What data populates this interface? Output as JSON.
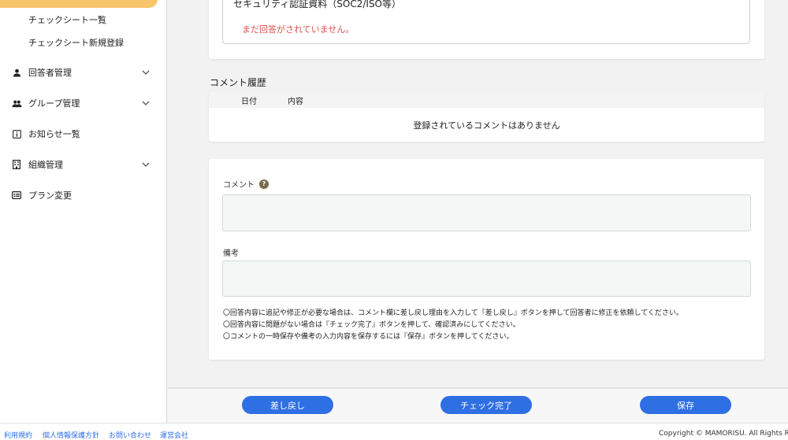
{
  "sidebar": {
    "sub_items": [
      "チェックシート一覧",
      "チェックシート新規登録"
    ],
    "items": [
      {
        "label": "回答者管理",
        "icon": "person-icon",
        "has_chevron": true
      },
      {
        "label": "グループ管理",
        "icon": "group-icon",
        "has_chevron": true
      },
      {
        "label": "お知らせ一覧",
        "icon": "info-icon",
        "has_chevron": false
      },
      {
        "label": "組織管理",
        "icon": "building-icon",
        "has_chevron": true
      },
      {
        "label": "プラン変更",
        "icon": "card-icon",
        "has_chevron": false
      }
    ],
    "active_color": "#f7c56a"
  },
  "answer": {
    "title": "セキュリティ認証資料（SOC2/ISO等）",
    "empty_text": "まだ回答がされていません。"
  },
  "comment_history": {
    "title": "コメント履歴",
    "columns": [
      "日付",
      "内容"
    ],
    "empty_text": "登録されているコメントはありません"
  },
  "form": {
    "comment_label": "コメント",
    "comment_value": "",
    "remarks_label": "備考",
    "remarks_value": "",
    "notes": [
      "〇回答内容に追記や修正が必要な場合は、コメント欄に差し戻し理由を入力して『差し戻し』ボタンを押して回答者に修正を依頼してください。",
      "〇回答内容に問題がない場合は『チェック完了』ボタンを押して、確認済みにしてください。",
      "〇コメントの一時保存や備考の入力内容を保存するには『保存』ボタンを押してください。"
    ]
  },
  "actions": {
    "return_label": "差し戻し",
    "complete_label": "チェック完了",
    "save_label": "保存",
    "button_color": "#2f6fe4"
  },
  "footer": {
    "links": [
      "利用規約",
      "個人情報保護方針",
      "お問い合わせ",
      "運営会社"
    ],
    "copyright": "Copyright © MAMORISU. All Rights Reserv"
  }
}
